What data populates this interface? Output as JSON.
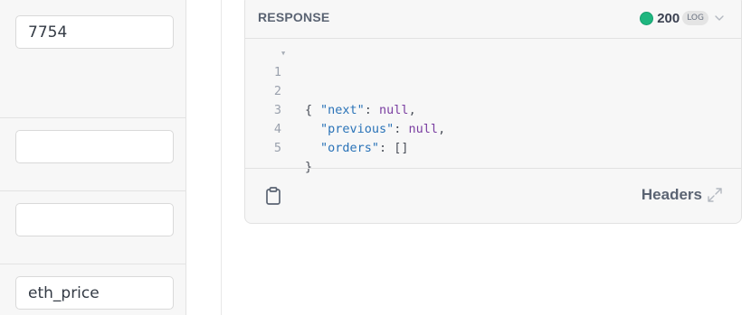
{
  "params": {
    "inputs": [
      {
        "value": "7754",
        "placeholder": ""
      },
      {
        "value": "",
        "placeholder": ""
      },
      {
        "value": "",
        "placeholder": ""
      },
      {
        "value": "eth_price",
        "placeholder": ""
      }
    ]
  },
  "response": {
    "title": "RESPONSE",
    "status_code": "200",
    "log_badge": "LOG",
    "status_color": "#1fb67f",
    "body_lines": [
      {
        "num": "1",
        "text": "{"
      },
      {
        "num": "2",
        "key": "\"next\"",
        "value": "null"
      },
      {
        "num": "3",
        "key": "\"previous\"",
        "value": "null"
      },
      {
        "num": "4",
        "key": "\"orders\"",
        "value": "[]"
      },
      {
        "num": "5",
        "text": "}"
      }
    ],
    "headers_label": "Headers",
    "icons": {
      "copy": "clipboard-icon",
      "expand": "expand-icon",
      "status_toggle": "chevron-down-icon"
    }
  }
}
